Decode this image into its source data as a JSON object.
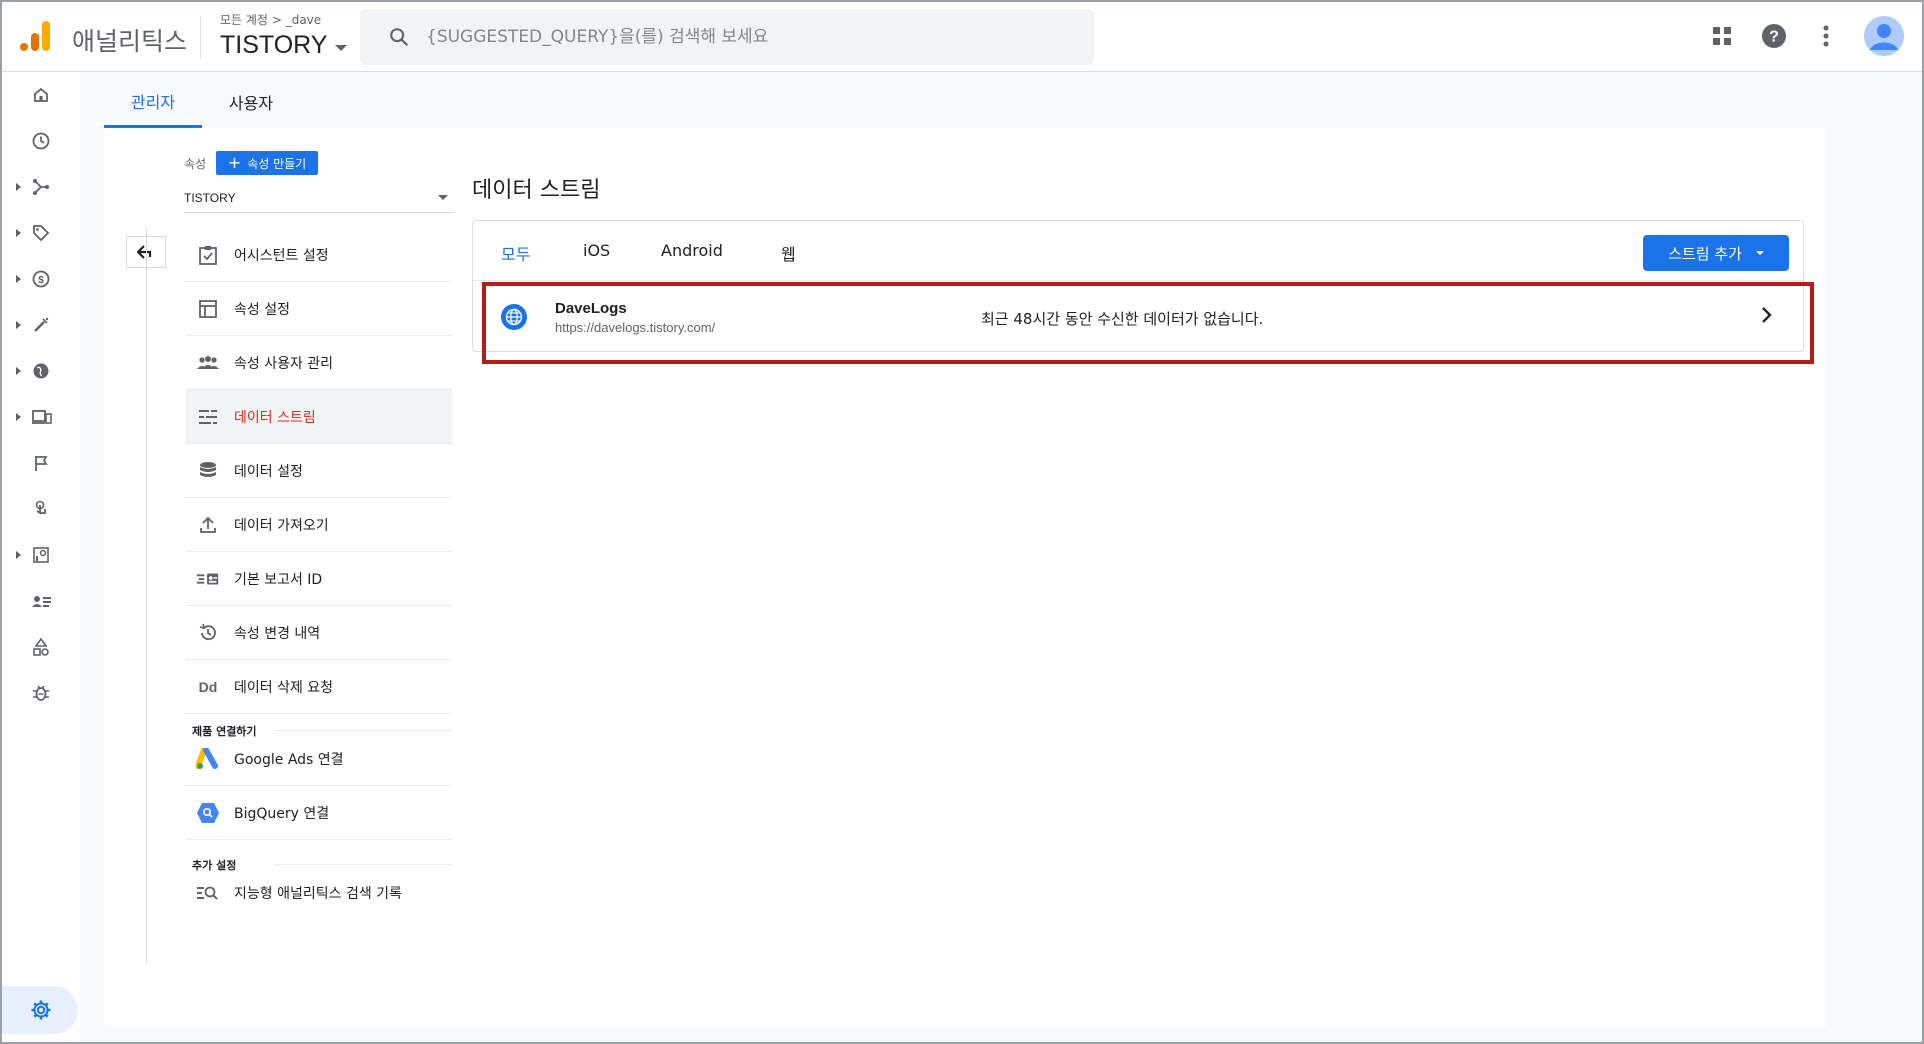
{
  "app": {
    "name": "애널리틱스"
  },
  "account": {
    "crumb_all": "모든 계정",
    "crumb_sep": ">",
    "crumb_account": "_dave",
    "property": "TISTORY"
  },
  "search": {
    "placeholder": "{SUGGESTED_QUERY}을(를) 검색해 보세요"
  },
  "admin_tabs": [
    {
      "label": "관리자",
      "active": true
    },
    {
      "label": "사용자",
      "active": false
    }
  ],
  "property_col": {
    "label": "속성",
    "create_button": "속성 만들기",
    "selected_property": "TISTORY",
    "menu": [
      {
        "label": "어시스턴트 설정",
        "icon": "checklist-icon"
      },
      {
        "label": "속성 설정",
        "icon": "layout-icon"
      },
      {
        "label": "속성 사용자 관리",
        "icon": "people-icon"
      },
      {
        "label": "데이터 스트림",
        "icon": "streams-icon",
        "active": true
      },
      {
        "label": "데이터 설정",
        "icon": "database-icon"
      },
      {
        "label": "데이터 가져오기",
        "icon": "upload-icon"
      },
      {
        "label": "기본 보고서 ID",
        "icon": "report-id-icon"
      },
      {
        "label": "속성 변경 내역",
        "icon": "history-icon"
      },
      {
        "label": "데이터 삭제 요청",
        "icon": "dd-icon"
      }
    ],
    "section_links": "제품 연결하기",
    "links": [
      {
        "label": "Google Ads 연결",
        "icon": "google-ads-icon"
      },
      {
        "label": "BigQuery 연결",
        "icon": "bigquery-icon"
      }
    ],
    "section_more": "추가 설정",
    "more": [
      {
        "label": "지능형 애널리틱스 검색 기록",
        "icon": "search-history-icon"
      }
    ],
    "dd_glyph": "Dd"
  },
  "streams": {
    "title": "데이터 스트림",
    "tabs": [
      {
        "label": "모두",
        "active": true
      },
      {
        "label": "iOS"
      },
      {
        "label": "Android"
      },
      {
        "label": "웹"
      }
    ],
    "add_button": "스트림 추가",
    "rows": [
      {
        "name": "DaveLogs",
        "url": "https://davelogs.tistory.com/",
        "status": "최근 48시간 동안 수신한 데이터가 없습니다."
      }
    ]
  },
  "colors": {
    "accent": "#1a73e8",
    "active_menu": "#d93025",
    "highlight": "#b71c1c"
  }
}
